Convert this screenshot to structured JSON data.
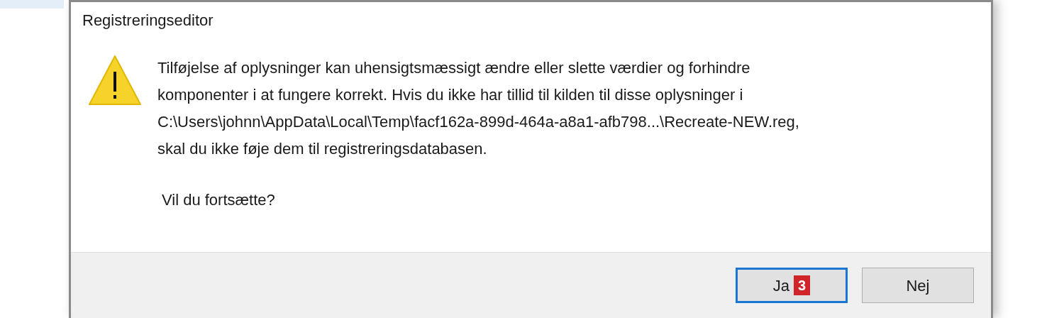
{
  "dialog": {
    "title": "Registreringseditor",
    "message_lines": [
      "Tilføjelse af oplysninger kan uhensigtsmæssigt ændre eller slette værdier og forhindre",
      "komponenter i at fungere korrekt. Hvis du ikke har tillid til kilden til disse oplysninger i",
      "C:\\Users\\johnn\\AppData\\Local\\Temp\\facf162a-899d-464a-a8a1-afb798...\\Recreate-NEW.reg,",
      "skal du ikke føje dem til registreringsdatabasen."
    ],
    "question": "Vil du fortsætte?",
    "buttons": [
      {
        "label": "Ja",
        "default": true,
        "badge": "3"
      },
      {
        "label": "Nej",
        "default": false
      }
    ]
  }
}
